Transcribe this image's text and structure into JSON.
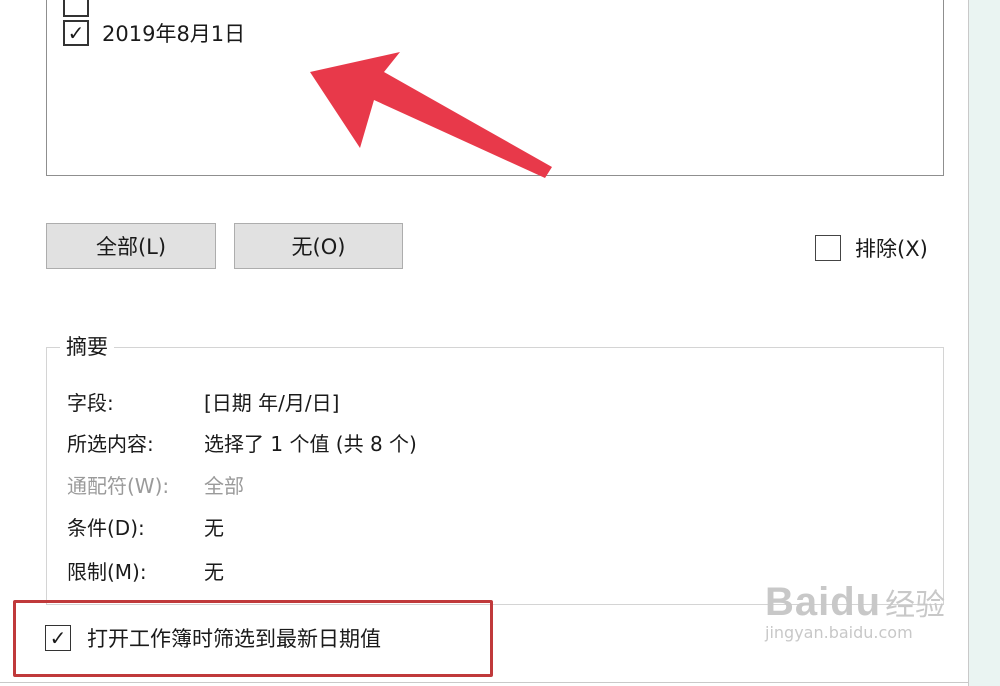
{
  "list": {
    "items": [
      {
        "label": "2019年8月1日",
        "checked": true
      }
    ]
  },
  "buttons": {
    "all_label": "全部(L)",
    "none_label": "无(O)"
  },
  "exclude": {
    "label": "排除(X)",
    "checked": false
  },
  "summary": {
    "title": "摘要",
    "field_label": "字段:",
    "field_value": "[日期 年/月/日]",
    "selected_label": "所选内容:",
    "selected_value": "选择了 1 个值 (共 8 个)",
    "wildcard_label": "通配符(W):",
    "wildcard_value": "全部",
    "condition_label": "条件(D):",
    "condition_value": "无",
    "limit_label": "限制(M):",
    "limit_value": "无"
  },
  "latest_option": {
    "label": "打开工作簿时筛选到最新日期值",
    "checked": true
  },
  "watermark": {
    "logo": "Baidu",
    "suffix": "经验",
    "url": "jingyan.baidu.com"
  },
  "colors": {
    "arrow": "#e8394a",
    "highlight": "#c0393b"
  }
}
